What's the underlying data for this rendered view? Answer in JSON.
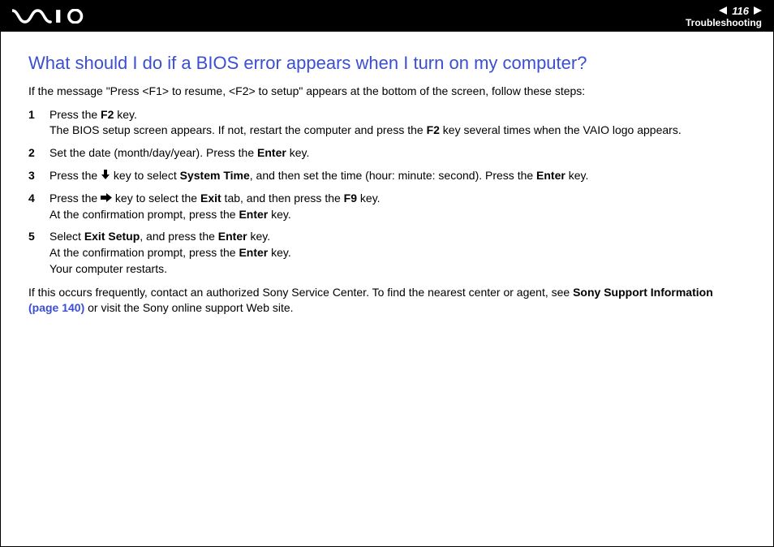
{
  "header": {
    "page_number": "116",
    "section": "Troubleshooting"
  },
  "title": "What should I do if a BIOS error appears when I turn on my computer?",
  "intro": "If the message \"Press <F1> to resume, <F2> to setup\" appears at the bottom of the screen, follow these steps:",
  "steps": {
    "s1": {
      "num": "1",
      "t1": "Press the ",
      "b1": "F2",
      "t2": " key.",
      "line2a": "The BIOS setup screen appears. If not, restart the computer and press the ",
      "line2b": "F2",
      "line2c": " key several times when the VAIO logo appears."
    },
    "s2": {
      "num": "2",
      "t1": "Set the date (month/day/year). Press the ",
      "b1": "Enter",
      "t2": " key."
    },
    "s3": {
      "num": "3",
      "t1": "Press the ",
      "t2": " key to select ",
      "b1": "System Time",
      "t3": ", and then set the time (hour: minute: second). Press the ",
      "b2": "Enter",
      "t4": " key."
    },
    "s4": {
      "num": "4",
      "t1": "Press the ",
      "t2": " key to select the ",
      "b1": "Exit",
      "t3": " tab, and then press the ",
      "b2": "F9",
      "t4": " key.",
      "line2a": "At the confirmation prompt, press the ",
      "line2b": "Enter",
      "line2c": " key."
    },
    "s5": {
      "num": "5",
      "t1": "Select ",
      "b1": "Exit Setup",
      "t2": ", and press the ",
      "b2": "Enter",
      "t3": " key.",
      "line2a": "At the confirmation prompt, press the ",
      "line2b": "Enter",
      "line2c": " key.",
      "line3": "Your computer restarts."
    }
  },
  "outro": {
    "t1": "If this occurs frequently, contact an authorized Sony Service Center. To find the nearest center or agent, see ",
    "b1": "Sony Support Information",
    "link": " (page 140)",
    "t2": " or visit the Sony online support Web site."
  }
}
